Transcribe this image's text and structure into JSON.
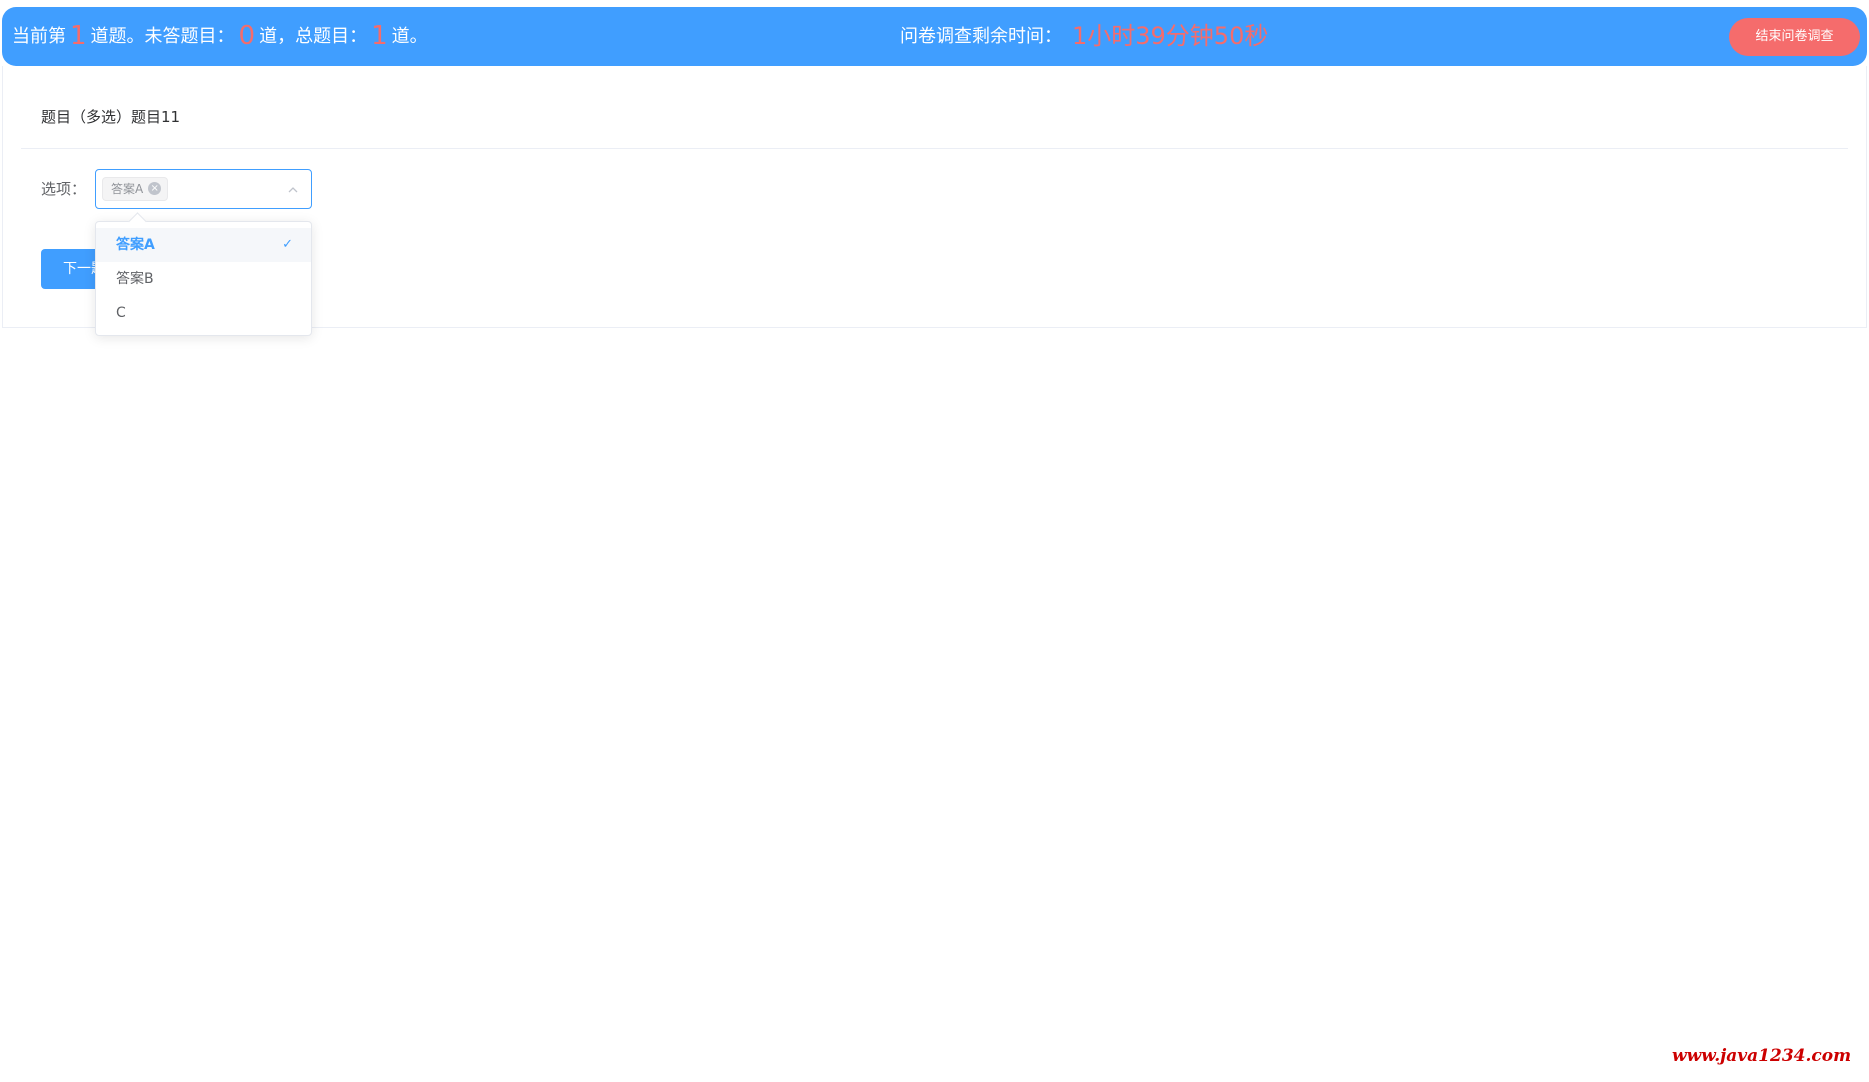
{
  "header": {
    "progress_prefix": "当前第",
    "current_index": "1",
    "progress_mid1": "道题。未答题目：",
    "unanswered": "0",
    "progress_mid2": "道，总题目：",
    "total": "1",
    "progress_suffix": "道。",
    "timer_label": "问卷调查剩余时间：",
    "timer_value": "1小时39分钟50秒",
    "end_button": "结束问卷调查"
  },
  "question": {
    "title": "题目（多选）题目11",
    "options_label": "选项：",
    "selected_tags": [
      "答案A"
    ],
    "dropdown_options": [
      {
        "label": "答案A",
        "selected": true
      },
      {
        "label": "答案B",
        "selected": false
      },
      {
        "label": "C",
        "selected": false
      }
    ],
    "next_button": "下一题"
  },
  "watermark": "www.java1234.com",
  "colors": {
    "primary": "#409eff",
    "danger": "#f56c6c",
    "border": "#ebeef5"
  }
}
